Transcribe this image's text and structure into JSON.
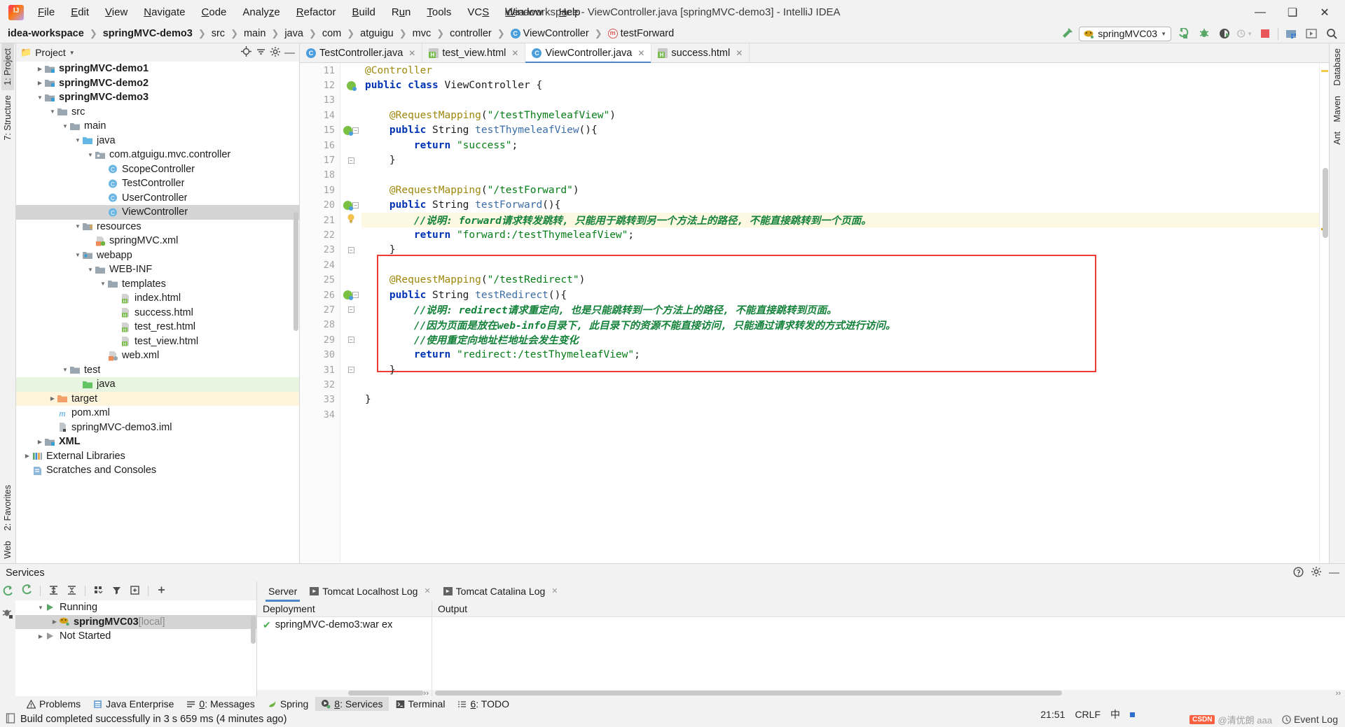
{
  "window": {
    "title": "idea-workspace - ViewController.java [springMVC-demo3] - IntelliJ IDEA",
    "minimize": "—",
    "maximize": "❐",
    "close": "✕",
    "logo_text": "IJ"
  },
  "menu": [
    {
      "label": "File"
    },
    {
      "label": "Edit"
    },
    {
      "label": "View"
    },
    {
      "label": "Navigate"
    },
    {
      "label": "Code"
    },
    {
      "label": "Analyze"
    },
    {
      "label": "Refactor"
    },
    {
      "label": "Build"
    },
    {
      "label": "Run"
    },
    {
      "label": "Tools"
    },
    {
      "label": "VCS"
    },
    {
      "label": "Window"
    },
    {
      "label": "Help"
    }
  ],
  "breadcrumbs": [
    {
      "label": "idea-workspace",
      "bold": true,
      "icon": "none"
    },
    {
      "label": "springMVC-demo3",
      "bold": true,
      "icon": "none"
    },
    {
      "label": "src",
      "bold": false,
      "icon": "none"
    },
    {
      "label": "main",
      "bold": false,
      "icon": "none"
    },
    {
      "label": "java",
      "bold": false,
      "icon": "none"
    },
    {
      "label": "com",
      "bold": false,
      "icon": "none"
    },
    {
      "label": "atguigu",
      "bold": false,
      "icon": "none"
    },
    {
      "label": "mvc",
      "bold": false,
      "icon": "none"
    },
    {
      "label": "controller",
      "bold": false,
      "icon": "none"
    },
    {
      "label": "ViewController",
      "bold": false,
      "icon": "class"
    },
    {
      "label": "testForward",
      "bold": false,
      "icon": "method"
    }
  ],
  "toolbar": {
    "run_config_name": "springMVC03",
    "icons": [
      "hammer-icon",
      "run-icon",
      "debug-icon",
      "run-coverage-icon",
      "profile-icon",
      "stop-icon",
      "project-structure-icon",
      "update-icon",
      "search-icon"
    ]
  },
  "project_panel": {
    "title": "Project",
    "header_icons": [
      "locate-icon",
      "collapse-all-icon",
      "settings-icon",
      "hide-icon"
    ],
    "tree": [
      {
        "label": "springMVC-demo1",
        "indent": 1,
        "tri": "▶",
        "icon": "module",
        "bold": true,
        "state": ""
      },
      {
        "label": "springMVC-demo2",
        "indent": 1,
        "tri": "▶",
        "icon": "module",
        "bold": true,
        "state": ""
      },
      {
        "label": "springMVC-demo3",
        "indent": 1,
        "tri": "▼",
        "icon": "module",
        "bold": true,
        "state": ""
      },
      {
        "label": "src",
        "indent": 2,
        "tri": "▼",
        "icon": "folder",
        "bold": false,
        "state": ""
      },
      {
        "label": "main",
        "indent": 3,
        "tri": "▼",
        "icon": "folder",
        "bold": false,
        "state": ""
      },
      {
        "label": "java",
        "indent": 4,
        "tri": "▼",
        "icon": "source-folder",
        "bold": false,
        "state": ""
      },
      {
        "label": "com.atguigu.mvc.controller",
        "indent": 5,
        "tri": "▼",
        "icon": "package",
        "bold": false,
        "state": ""
      },
      {
        "label": "ScopeController",
        "indent": 6,
        "tri": "none",
        "icon": "class",
        "bold": false,
        "state": ""
      },
      {
        "label": "TestController",
        "indent": 6,
        "tri": "none",
        "icon": "class",
        "bold": false,
        "state": ""
      },
      {
        "label": "UserController",
        "indent": 6,
        "tri": "none",
        "icon": "class",
        "bold": false,
        "state": ""
      },
      {
        "label": "ViewController",
        "indent": 6,
        "tri": "none",
        "icon": "class",
        "bold": false,
        "state": "selected"
      },
      {
        "label": "resources",
        "indent": 4,
        "tri": "▼",
        "icon": "resource-folder",
        "bold": false,
        "state": ""
      },
      {
        "label": "springMVC.xml",
        "indent": 5,
        "tri": "none",
        "icon": "spring-xml",
        "bold": false,
        "state": ""
      },
      {
        "label": "webapp",
        "indent": 4,
        "tri": "▼",
        "icon": "webapp",
        "bold": false,
        "state": ""
      },
      {
        "label": "WEB-INF",
        "indent": 5,
        "tri": "▼",
        "icon": "folder",
        "bold": false,
        "state": ""
      },
      {
        "label": "templates",
        "indent": 6,
        "tri": "▼",
        "icon": "folder",
        "bold": false,
        "state": ""
      },
      {
        "label": "index.html",
        "indent": 7,
        "tri": "none",
        "icon": "html",
        "bold": false,
        "state": ""
      },
      {
        "label": "success.html",
        "indent": 7,
        "tri": "none",
        "icon": "html",
        "bold": false,
        "state": ""
      },
      {
        "label": "test_rest.html",
        "indent": 7,
        "tri": "none",
        "icon": "html",
        "bold": false,
        "state": ""
      },
      {
        "label": "test_view.html",
        "indent": 7,
        "tri": "none",
        "icon": "html",
        "bold": false,
        "state": ""
      },
      {
        "label": "web.xml",
        "indent": 6,
        "tri": "none",
        "icon": "web-xml",
        "bold": false,
        "state": ""
      },
      {
        "label": "test",
        "indent": 3,
        "tri": "▼",
        "icon": "folder",
        "bold": false,
        "state": ""
      },
      {
        "label": "java",
        "indent": 4,
        "tri": "none",
        "icon": "test-source-folder",
        "bold": false,
        "state": "green"
      },
      {
        "label": "target",
        "indent": 2,
        "tri": "▶",
        "icon": "target-folder",
        "bold": false,
        "state": "yellow"
      },
      {
        "label": "pom.xml",
        "indent": 2,
        "tri": "none",
        "icon": "maven",
        "bold": false,
        "state": ""
      },
      {
        "label": "springMVC-demo3.iml",
        "indent": 2,
        "tri": "none",
        "icon": "iml",
        "bold": false,
        "state": ""
      },
      {
        "label": "XML",
        "indent": 1,
        "tri": "▶",
        "icon": "module",
        "bold": true,
        "state": ""
      },
      {
        "label": "External Libraries",
        "indent": 0,
        "tri": "▶",
        "icon": "libraries",
        "bold": false,
        "state": ""
      },
      {
        "label": "Scratches and Consoles",
        "indent": 0,
        "tri": "none",
        "icon": "scratches",
        "bold": false,
        "state": ""
      }
    ]
  },
  "left_rail": [
    {
      "label": "1: Project",
      "selected": true
    },
    {
      "label": "7: Structure",
      "selected": false
    },
    {
      "label": "2: Favorites",
      "selected": false
    },
    {
      "label": "Web",
      "selected": false
    }
  ],
  "right_rail": [
    {
      "label": "Database",
      "selected": false
    },
    {
      "label": "Maven",
      "selected": false
    },
    {
      "label": "Ant",
      "selected": false
    }
  ],
  "editor": {
    "tabs": [
      {
        "label": "TestController.java",
        "icon": "java",
        "active": false,
        "close": "✕"
      },
      {
        "label": "test_view.html",
        "icon": "html",
        "active": false,
        "close": "✕"
      },
      {
        "label": "ViewController.java",
        "icon": "java",
        "active": true,
        "close": "✕"
      },
      {
        "label": "success.html",
        "icon": "html",
        "active": false,
        "close": "✕"
      }
    ],
    "first_line_number": 11,
    "lines": [
      {
        "n": 11,
        "gutter": "",
        "fold": "",
        "hl": false,
        "tokens": [
          {
            "t": "@Controller",
            "c": "ann",
            "pad": 0
          }
        ]
      },
      {
        "n": 12,
        "gutter": "bean",
        "fold": "",
        "hl": false,
        "tokens": [
          {
            "t": "public class ",
            "c": "kw",
            "pad": 0
          },
          {
            "t": "ViewController",
            "c": "pl"
          },
          {
            "t": " {",
            "c": "pl"
          }
        ]
      },
      {
        "n": 13,
        "gutter": "",
        "fold": "",
        "hl": false,
        "tokens": []
      },
      {
        "n": 14,
        "gutter": "",
        "fold": "",
        "hl": false,
        "tokens": [
          {
            "t": "    @RequestMapping",
            "c": "ann"
          },
          {
            "t": "(",
            "c": "pl"
          },
          {
            "t": "\"/testThymeleafView\"",
            "c": "str"
          },
          {
            "t": ")",
            "c": "pl"
          }
        ]
      },
      {
        "n": 15,
        "gutter": "bean",
        "fold": "foldtop",
        "hl": false,
        "tokens": [
          {
            "t": "    public ",
            "c": "kw"
          },
          {
            "t": "String ",
            "c": "pl"
          },
          {
            "t": "testThymeleafView",
            "c": "mth"
          },
          {
            "t": "(){",
            "c": "pl"
          }
        ]
      },
      {
        "n": 16,
        "gutter": "",
        "fold": "",
        "hl": false,
        "tokens": [
          {
            "t": "        return ",
            "c": "kw"
          },
          {
            "t": "\"success\"",
            "c": "str"
          },
          {
            "t": ";",
            "c": "pl"
          }
        ]
      },
      {
        "n": 17,
        "gutter": "",
        "fold": "foldbot",
        "hl": false,
        "tokens": [
          {
            "t": "    }",
            "c": "pl"
          }
        ]
      },
      {
        "n": 18,
        "gutter": "",
        "fold": "",
        "hl": false,
        "tokens": []
      },
      {
        "n": 19,
        "gutter": "",
        "fold": "",
        "hl": false,
        "tokens": [
          {
            "t": "    @RequestMapping",
            "c": "ann"
          },
          {
            "t": "(",
            "c": "pl"
          },
          {
            "t": "\"/testForward\"",
            "c": "str"
          },
          {
            "t": ")",
            "c": "pl"
          }
        ]
      },
      {
        "n": 20,
        "gutter": "bean",
        "fold": "foldtop",
        "hl": false,
        "tokens": [
          {
            "t": "    public ",
            "c": "kw"
          },
          {
            "t": "String ",
            "c": "pl"
          },
          {
            "t": "testForward",
            "c": "mth"
          },
          {
            "t": "(){",
            "c": "pl"
          }
        ]
      },
      {
        "n": 21,
        "gutter": "bulb",
        "fold": "",
        "hl": true,
        "tokens": [
          {
            "t": "        //说明: forward请求转发跳转, 只能用于跳转到另一个方法上的路径, 不能直接跳转到一个页面。",
            "c": "cmt"
          }
        ]
      },
      {
        "n": 22,
        "gutter": "",
        "fold": "",
        "hl": false,
        "tokens": [
          {
            "t": "        return ",
            "c": "kw"
          },
          {
            "t": "\"forward:/testThymeleafView\"",
            "c": "str"
          },
          {
            "t": ";",
            "c": "pl"
          }
        ]
      },
      {
        "n": 23,
        "gutter": "",
        "fold": "foldbot",
        "hl": false,
        "tokens": [
          {
            "t": "    }",
            "c": "pl"
          }
        ]
      },
      {
        "n": 24,
        "gutter": "",
        "fold": "",
        "hl": false,
        "tokens": []
      },
      {
        "n": 25,
        "gutter": "",
        "fold": "",
        "hl": false,
        "tokens": [
          {
            "t": "    @RequestMapping",
            "c": "ann"
          },
          {
            "t": "(",
            "c": "pl"
          },
          {
            "t": "\"/testRedirect\"",
            "c": "str"
          },
          {
            "t": ")",
            "c": "pl"
          }
        ]
      },
      {
        "n": 26,
        "gutter": "bean",
        "fold": "foldtop",
        "hl": false,
        "tokens": [
          {
            "t": "    public ",
            "c": "kw"
          },
          {
            "t": "String ",
            "c": "pl"
          },
          {
            "t": "testRedirect",
            "c": "mth"
          },
          {
            "t": "(){",
            "c": "pl"
          }
        ]
      },
      {
        "n": 27,
        "gutter": "",
        "fold": "foldv",
        "hl": false,
        "tokens": [
          {
            "t": "        //说明: redirect请求重定向, 也是只能跳转到一个方法上的路径, 不能直接跳转到页面。",
            "c": "cmt"
          }
        ]
      },
      {
        "n": 28,
        "gutter": "",
        "fold": "",
        "hl": false,
        "tokens": [
          {
            "t": "        //因为页面是放在web-info目录下, 此目录下的资源不能直接访问, 只能通过请求转发的方式进行访问。",
            "c": "cmt"
          }
        ]
      },
      {
        "n": 29,
        "gutter": "",
        "fold": "foldv",
        "hl": false,
        "tokens": [
          {
            "t": "        //使用重定向地址栏地址会发生变化",
            "c": "cmt"
          }
        ]
      },
      {
        "n": 30,
        "gutter": "",
        "fold": "",
        "hl": false,
        "tokens": [
          {
            "t": "        return ",
            "c": "kw"
          },
          {
            "t": "\"redirect:/testThymeleafView\"",
            "c": "str"
          },
          {
            "t": ";",
            "c": "pl"
          }
        ]
      },
      {
        "n": 31,
        "gutter": "",
        "fold": "foldbot",
        "hl": false,
        "tokens": [
          {
            "t": "    }",
            "c": "pl"
          }
        ]
      },
      {
        "n": 32,
        "gutter": "",
        "fold": "",
        "hl": false,
        "tokens": []
      },
      {
        "n": 33,
        "gutter": "",
        "fold": "",
        "hl": false,
        "tokens": [
          {
            "t": "}",
            "c": "pl"
          }
        ]
      },
      {
        "n": 34,
        "gutter": "",
        "fold": "",
        "hl": false,
        "tokens": []
      }
    ]
  },
  "services": {
    "title": "Services",
    "header_icons": [
      "help-icon",
      "settings-icon",
      "hide-icon"
    ],
    "toolbar_icons": [
      "rerun-icon",
      "expand-all-icon",
      "collapse-all-icon",
      "group-icon",
      "filter-icon",
      "add-frame-icon",
      "add-icon"
    ],
    "side_icons": [
      "rerun-service-icon",
      "debug-service-icon"
    ],
    "tree": [
      {
        "label": "Running",
        "indent": 1,
        "tri": "▼",
        "icon": "run-green",
        "bold": false,
        "selected": false,
        "suffix": ""
      },
      {
        "label": "springMVC03",
        "indent": 2,
        "tri": "▶",
        "icon": "tomcat",
        "bold": true,
        "selected": true,
        "suffix": "[local]"
      },
      {
        "label": "Not Started",
        "indent": 1,
        "tri": "▶",
        "icon": "not-started",
        "bold": false,
        "selected": false,
        "suffix": ""
      }
    ],
    "tabs": [
      {
        "label": "Server",
        "icon": "none",
        "active": true
      },
      {
        "label": "Tomcat Localhost Log",
        "icon": "log",
        "active": false,
        "close": "✕"
      },
      {
        "label": "Tomcat Catalina Log",
        "icon": "log",
        "active": false,
        "close": "✕"
      }
    ],
    "columns": [
      {
        "header": "Deployment"
      },
      {
        "header": "Output"
      }
    ],
    "deployment_items": [
      {
        "label": "springMVC-demo3:war ex",
        "status": "✔"
      }
    ],
    "scroll_arrow": "››"
  },
  "statusbar": {
    "tabs": [
      {
        "label": "Problems",
        "icon": "warning-icon",
        "active": false,
        "num": ""
      },
      {
        "label": "Java Enterprise",
        "icon": "java-ee-icon",
        "active": false,
        "num": ""
      },
      {
        "label": "0: Messages",
        "icon": "messages-icon",
        "active": false,
        "num": "0"
      },
      {
        "label": "Spring",
        "icon": "spring-icon",
        "active": false,
        "num": ""
      },
      {
        "label": "8: Services",
        "icon": "services-icon",
        "active": true,
        "num": "8"
      },
      {
        "label": "Terminal",
        "icon": "terminal-icon",
        "active": false,
        "num": ""
      },
      {
        "label": "6: TODO",
        "icon": "todo-icon",
        "active": false,
        "num": "6"
      }
    ],
    "message": "Build completed successfully in 3 s 659 ms (4 minutes ago)",
    "event_log": "Event Log",
    "time": "21:51",
    "ime": "中",
    "encoding": "CRLF",
    "watermark_brand": "CSDN",
    "watermark_user": "@清优朗 aaa"
  },
  "colors": {
    "accent_blue": "#4a86c8",
    "red_box": "#ef3b36",
    "keyword": "#0033b3",
    "string": "#067d17",
    "comment": "#15823b",
    "annotation": "#9e880d",
    "selection_gray": "#d4d4d4",
    "highlight_yellow": "#fdf8e2",
    "green_row": "#e8f5e0",
    "tomcat_green": "#4caf50"
  }
}
